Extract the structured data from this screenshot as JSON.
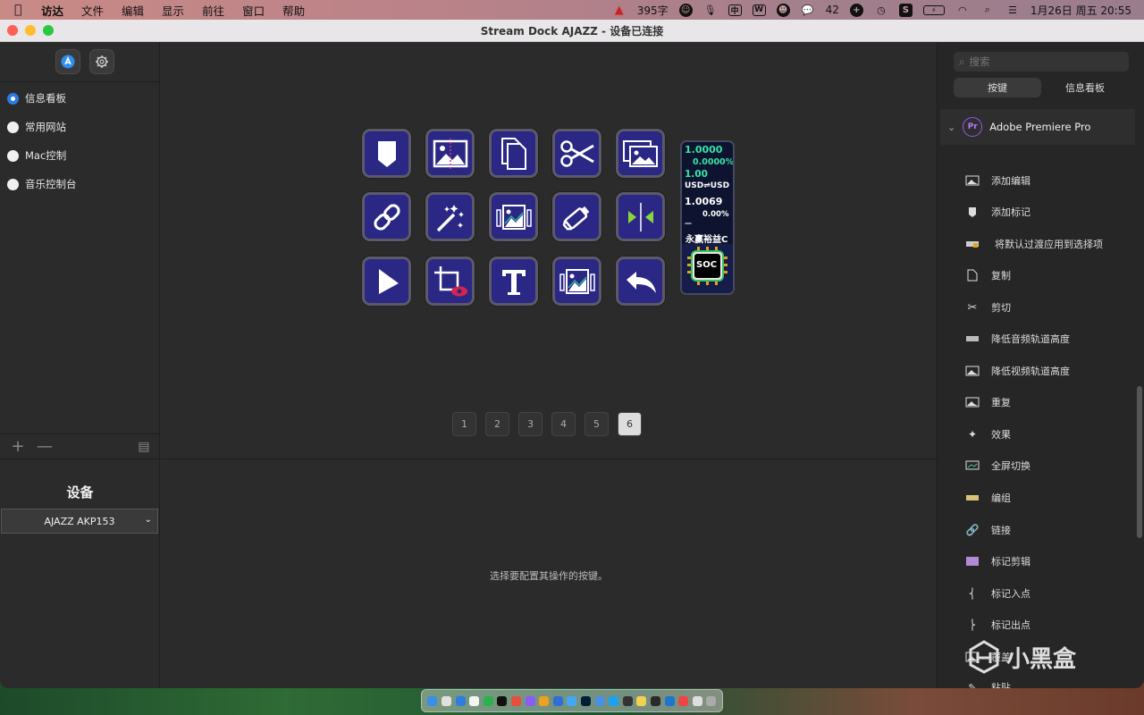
{
  "menubar": {
    "app": "访达",
    "items": [
      "文件",
      "编辑",
      "显示",
      "前往",
      "窗口",
      "帮助"
    ],
    "word_count": "395字",
    "wechat_badge": "42",
    "datetime": "1月26日 周五  20:55"
  },
  "window": {
    "title": "Stream Dock AJAZZ - 设备已连接"
  },
  "left": {
    "profiles": [
      {
        "label": "信息看板",
        "selected": true
      },
      {
        "label": "常用网站",
        "selected": false
      },
      {
        "label": "Mac控制",
        "selected": false
      },
      {
        "label": "音乐控制台",
        "selected": false
      }
    ],
    "device_label": "设备",
    "device_selected": "AJAZZ AKP153"
  },
  "center": {
    "keys": [
      [
        "marker-icon",
        "image-icon",
        "copy-icon",
        "scissors-icon",
        "images-icon"
      ],
      [
        "link-icon",
        "magic-wand-icon",
        "gallery-icon",
        "tube-icon",
        "in-out-icon"
      ],
      [
        "pointer-icon",
        "crop-eye-icon",
        "text-icon",
        "gallery2-icon",
        "undo-icon"
      ]
    ],
    "widget": {
      "rate1": "1.0000",
      "pct1": "0.0000%",
      "rate2": "1.00",
      "pair": "USD⇌USD",
      "rate3": "1.0069",
      "pct2": "0.00%",
      "dash": "—",
      "fund": "永赢裕益C",
      "chip": "SOC"
    },
    "pages": [
      "1",
      "2",
      "3",
      "4",
      "5",
      "6"
    ],
    "active_page": "6",
    "hint": "选择要配置其操作的按键。"
  },
  "right": {
    "search_placeholder": "搜索",
    "tabs": [
      "按键",
      "信息看板"
    ],
    "category": "Adobe Premiere Pro",
    "category_badge": "Pr",
    "items": [
      "添加编辑",
      "添加标记",
      "将默认过渡应用到选择项",
      "复制",
      "剪切",
      "降低音频轨道高度",
      "降低视频轨道高度",
      "重复",
      "效果",
      "全屏切换",
      "编组",
      "链接",
      "标记剪辑",
      "标记入点",
      "标记出点",
      "覆盖",
      "粘贴"
    ]
  },
  "watermark": "小黑盒"
}
